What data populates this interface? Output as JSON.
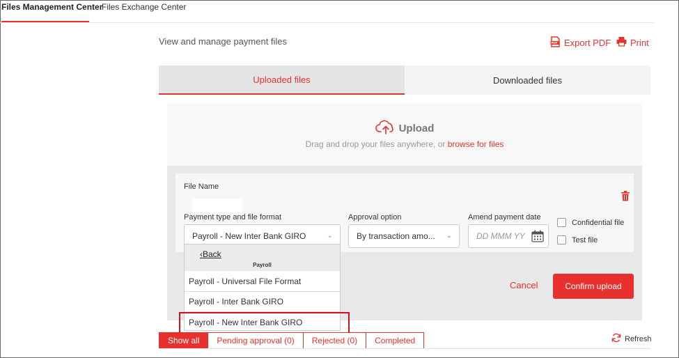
{
  "top_tabs": [
    "Files Management Center",
    "Files Exchange Center"
  ],
  "subtitle": "View and manage payment files",
  "actions": {
    "export_pdf": "Export PDF",
    "print": "Print"
  },
  "file_tabs": [
    "Uploaded files",
    "Downloaded files"
  ],
  "upload": {
    "title": "Upload",
    "hint": "Drag and drop your files anywhere, or ",
    "browse": "browse for files"
  },
  "form": {
    "file_name_label": "File Name",
    "payment_type_label": "Payment type and file format",
    "payment_type_value": "Payroll - New Inter Bank GIRO",
    "approval_label": "Approval option",
    "approval_value": "By transaction amo...",
    "amend_date_label": "Amend payment date",
    "amend_date_placeholder": "DD MMM YY",
    "confidential_label": "Confidential file",
    "test_label": "Test file"
  },
  "dropdown": {
    "back": "Back",
    "group": "Payroll",
    "options": [
      "Payroll - Universal File Format",
      "Payroll - Inter Bank GIRO",
      "Payroll - New Inter Bank GIRO"
    ]
  },
  "buttons": {
    "cancel": "Cancel",
    "confirm": "Confirm upload"
  },
  "filters": [
    "Show all",
    "Pending approval (0)",
    "Rejected (0)",
    "Completed"
  ],
  "refresh": "Refresh",
  "colors": {
    "accent": "#e8312f",
    "highlight": "#d0111b"
  }
}
